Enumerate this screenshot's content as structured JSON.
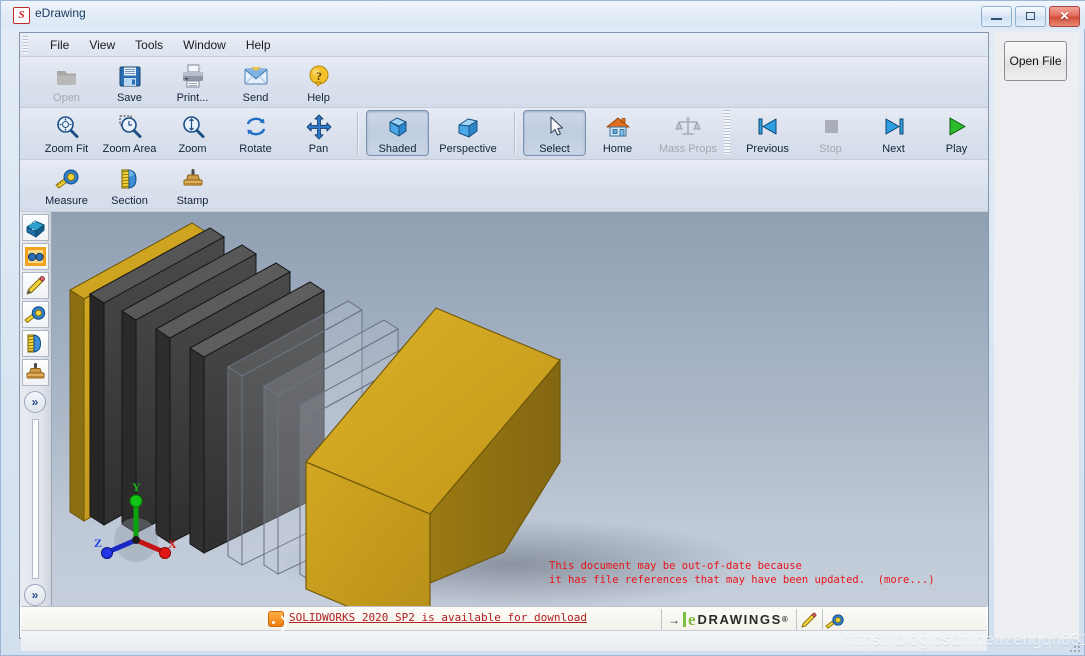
{
  "window": {
    "title": "eDrawing",
    "app_icon": "solidworks-s-icon",
    "minimize_label": "Minimize",
    "maximize_label": "Maximize",
    "close_label": "✕"
  },
  "menu": {
    "items": [
      {
        "label": "File"
      },
      {
        "label": "View"
      },
      {
        "label": "Tools"
      },
      {
        "label": "Window"
      },
      {
        "label": "Help"
      }
    ]
  },
  "toolbar": {
    "row1": [
      {
        "label": "Open",
        "icon": "open-folder-icon",
        "state": "disabled"
      },
      {
        "label": "Save",
        "icon": "save-disk-icon",
        "state": "normal"
      },
      {
        "label": "Print...",
        "icon": "printer-icon",
        "state": "normal"
      },
      {
        "label": "Send",
        "icon": "envelope-icon",
        "state": "normal"
      },
      {
        "label": "Help",
        "icon": "question-help-icon",
        "state": "normal"
      }
    ],
    "row2": [
      {
        "label": "Zoom Fit",
        "icon": "zoom-fit-icon",
        "state": "normal"
      },
      {
        "label": "Zoom Area",
        "icon": "zoom-area-icon",
        "state": "normal"
      },
      {
        "label": "Zoom",
        "icon": "zoom-icon",
        "state": "normal"
      },
      {
        "label": "Rotate",
        "icon": "rotate-icon",
        "state": "normal"
      },
      {
        "label": "Pan",
        "icon": "pan-arrows-icon",
        "state": "normal"
      },
      {
        "label": "Shaded",
        "icon": "shaded-cube-icon",
        "state": "pressed"
      },
      {
        "label": "Perspective",
        "icon": "perspective-icon",
        "state": "normal"
      },
      {
        "label": "Select",
        "icon": "select-cursor-icon",
        "state": "pressed"
      },
      {
        "label": "Home",
        "icon": "home-house-icon",
        "state": "normal"
      },
      {
        "label": "Mass Props",
        "icon": "mass-props-scale-icon",
        "state": "disabled"
      }
    ],
    "row2_right": [
      {
        "label": "Previous",
        "icon": "previous-icon",
        "state": "normal"
      },
      {
        "label": "Stop",
        "icon": "stop-icon",
        "state": "disabled"
      },
      {
        "label": "Next",
        "icon": "next-icon",
        "state": "normal"
      },
      {
        "label": "Play",
        "icon": "play-icon",
        "state": "normal"
      }
    ],
    "row3": [
      {
        "label": "Measure",
        "icon": "measure-tape-icon",
        "state": "normal"
      },
      {
        "label": "Section",
        "icon": "section-view-icon",
        "state": "normal"
      },
      {
        "label": "Stamp",
        "icon": "stamp-icon",
        "state": "normal"
      }
    ]
  },
  "sidebar": {
    "items": [
      {
        "icon": "components-tree-icon",
        "label": "Components"
      },
      {
        "icon": "markup-glasses-icon",
        "label": "Markup"
      },
      {
        "icon": "pencil-icon",
        "label": "Annotate"
      },
      {
        "icon": "measure-tape-icon",
        "label": "Measure"
      },
      {
        "icon": "section-view-icon",
        "label": "Section"
      },
      {
        "icon": "stamp-icon",
        "label": "Stamp"
      }
    ],
    "expand_top_label": "»",
    "expand_bottom_label": "»"
  },
  "viewport": {
    "warning_line1": "This document may be out-of-date because",
    "warning_line2": "it has file references that may have been updated.  (more...)",
    "warning_color": "#e8131a",
    "axis": {
      "x": "X",
      "y": "Y",
      "z": "Z"
    },
    "background_top": "#919fb3",
    "background_bottom": "#c6cfdb",
    "model_gold": "#c8a01e",
    "model_gold_dark": "#8f7314",
    "model_dark": "#3a3a3a"
  },
  "status": {
    "rss_icon": "rss-feed-icon",
    "link_text": "SOLIDWORKS 2020 SP2 is available for download",
    "brand_e": "e",
    "brand_text": "DRAWINGS",
    "brand_reg": "®",
    "tool_icons": [
      {
        "icon": "pencil-icon"
      },
      {
        "icon": "measure-tape-icon"
      }
    ]
  },
  "right_panel": {
    "open_file_label": "Open File"
  },
  "watermark": {
    "text": "https://blog.csdn.net/zengqh0314"
  }
}
